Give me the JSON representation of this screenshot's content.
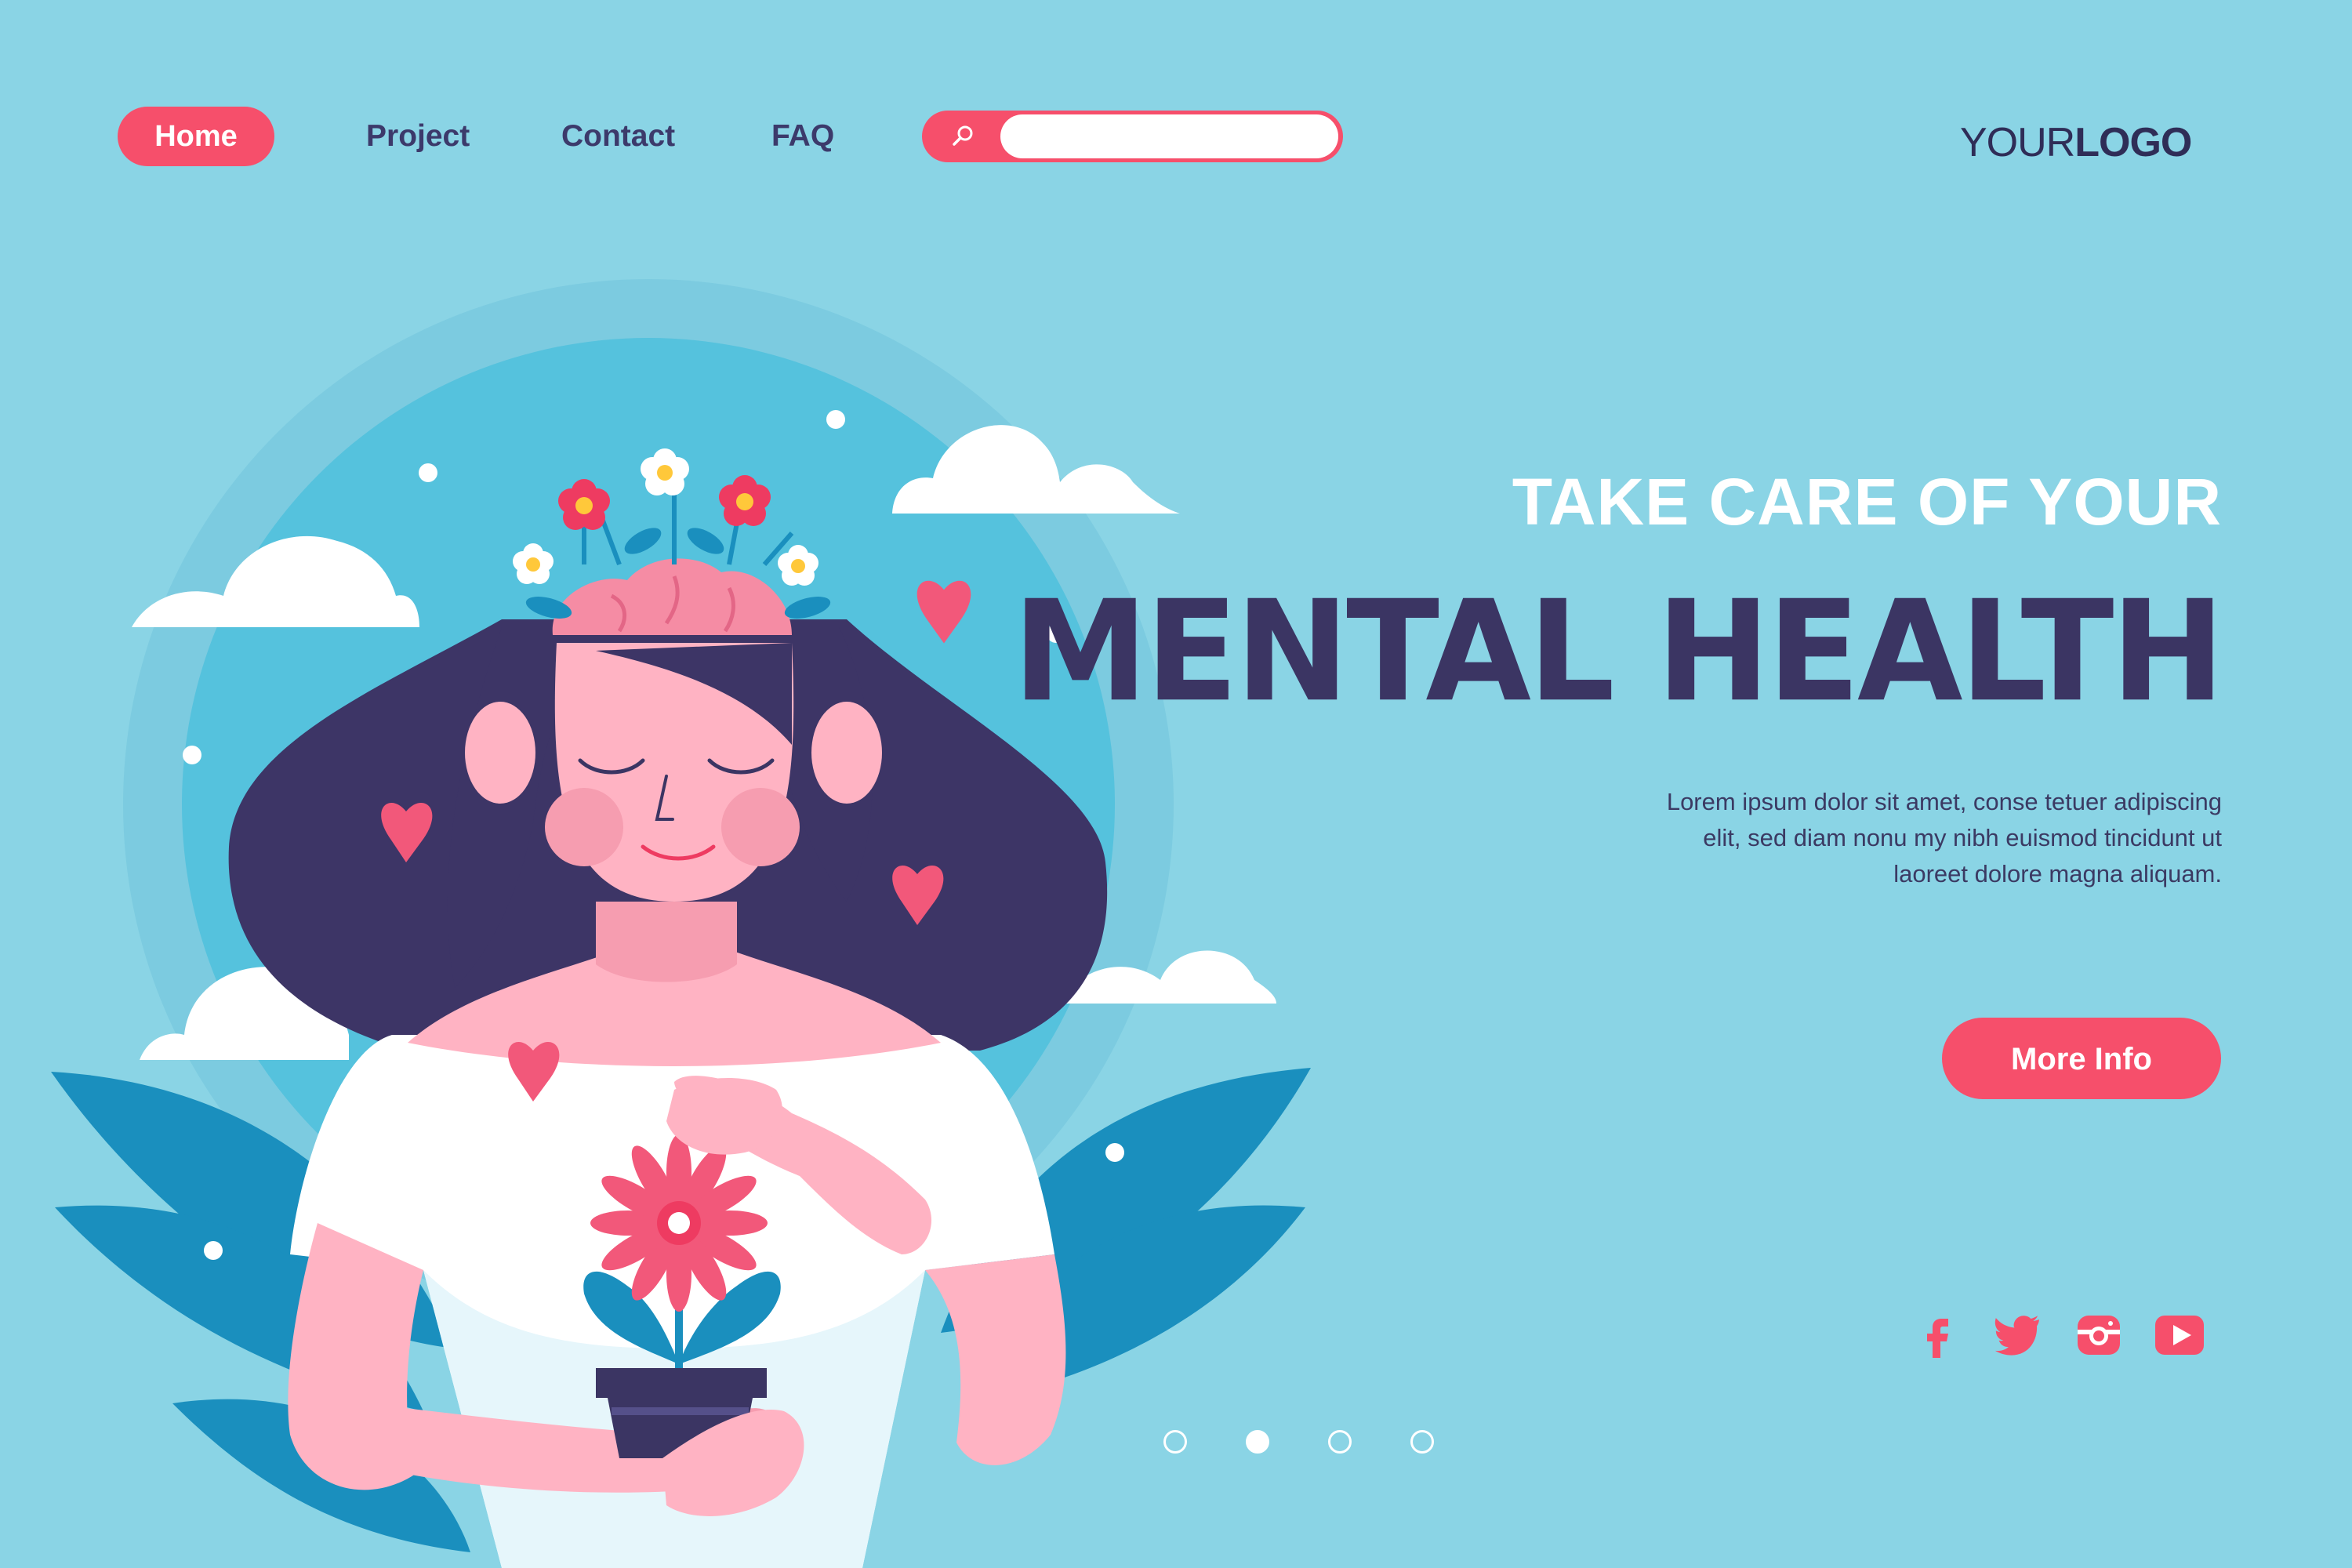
{
  "nav": {
    "home": "Home",
    "project": "Project",
    "contact": "Contact",
    "faq": "FAQ"
  },
  "search": {
    "placeholder": "",
    "value": ""
  },
  "logo": {
    "part1": "YOUR",
    "part2": "LOGO"
  },
  "hero": {
    "tagline": "TAKE CARE OF YOUR",
    "headline": "MENTAL HEALTH",
    "body": "Lorem ipsum dolor sit amet, conse tetuer adipiscing elit, sed diam nonu my nibh euismod tincidunt ut laoreet dolore magna aliquam.",
    "button": "More Info"
  },
  "social": [
    "facebook-icon",
    "twitter-icon",
    "instagram-icon",
    "youtube-icon"
  ],
  "carousel": {
    "total": 4,
    "active": 2
  },
  "colors": {
    "background": "#8ad4e5",
    "accent": "#f64f6b",
    "dark": "#3b3563",
    "hair": "#3d3566",
    "skin": "#ffb3c3"
  }
}
